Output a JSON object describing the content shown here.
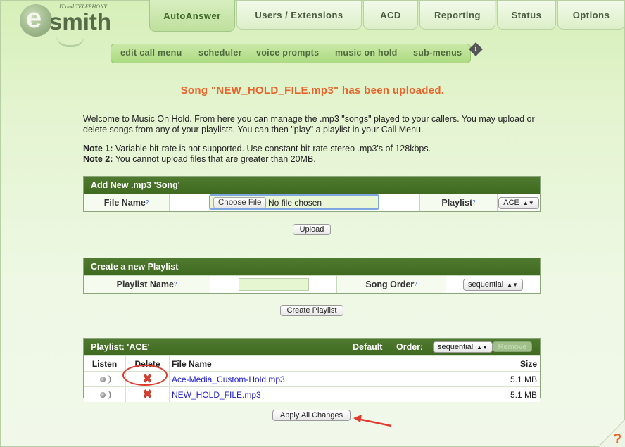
{
  "logo": {
    "letter": "e",
    "word": "smith",
    "tagline": "IT and TELEPHONY"
  },
  "main_tabs": [
    {
      "label": "AutoAnswer",
      "active": true
    },
    {
      "label": "Users / Extensions",
      "active": false
    },
    {
      "label": "ACD",
      "active": false
    },
    {
      "label": "Reporting",
      "active": false
    },
    {
      "label": "Status",
      "active": false
    },
    {
      "label": "Options",
      "active": false
    }
  ],
  "sub_tabs": [
    {
      "label": "edit call menu"
    },
    {
      "label": "scheduler"
    },
    {
      "label": "voice prompts"
    },
    {
      "label": "music on hold"
    },
    {
      "label": "sub-menus"
    }
  ],
  "info_icon": "i",
  "upload_message": "Song \"NEW_HOLD_FILE.mp3\" has been uploaded.",
  "welcome": "Welcome to Music On Hold. From here you can manage the .mp3 \"songs\" played to your callers. You may upload or delete songs from any of your playlists. You can then \"play\" a playlist in your Call Menu.",
  "notes": [
    {
      "label": "Note 1:",
      "text": " Variable bit-rate is not supported. Use constant bit-rate stereo .mp3's of 128kbps."
    },
    {
      "label": "Note 2:",
      "text": " You cannot upload files that are greater than 20MB."
    }
  ],
  "add_song": {
    "title": "Add New .mp3 'Song'",
    "file_name_label": "File Name",
    "help_mark": "?",
    "choose_file_label": "Choose File",
    "no_file_text": "No file chosen",
    "playlist_label": "Playlist",
    "playlist_value": "ACE",
    "upload_button": "Upload"
  },
  "create_playlist": {
    "title": "Create a new Playlist",
    "name_label": "Playlist Name",
    "order_label": "Song Order",
    "order_value": "sequential",
    "create_button": "Create Playlist"
  },
  "playlist": {
    "title": "Playlist: 'ACE'",
    "default_label": "Default",
    "order_label": "Order:",
    "order_value": "sequential",
    "remove_button": "Remove",
    "columns": {
      "listen": "Listen",
      "delete": "Delete",
      "file_name": "File Name",
      "size": "Size"
    },
    "songs": [
      {
        "file_name": "Ace-Media_Custom-Hold.mp3",
        "size": "5.1 MB"
      },
      {
        "file_name": "NEW_HOLD_FILE.mp3",
        "size": "5.1 MB"
      }
    ]
  },
  "apply_button": "Apply All Changes",
  "help_glyph": "?",
  "colors": {
    "accent_green": "#3f6a20",
    "message_orange": "#e8642a",
    "annotation_red": "#e03a2c",
    "link_blue": "#2020cc"
  }
}
